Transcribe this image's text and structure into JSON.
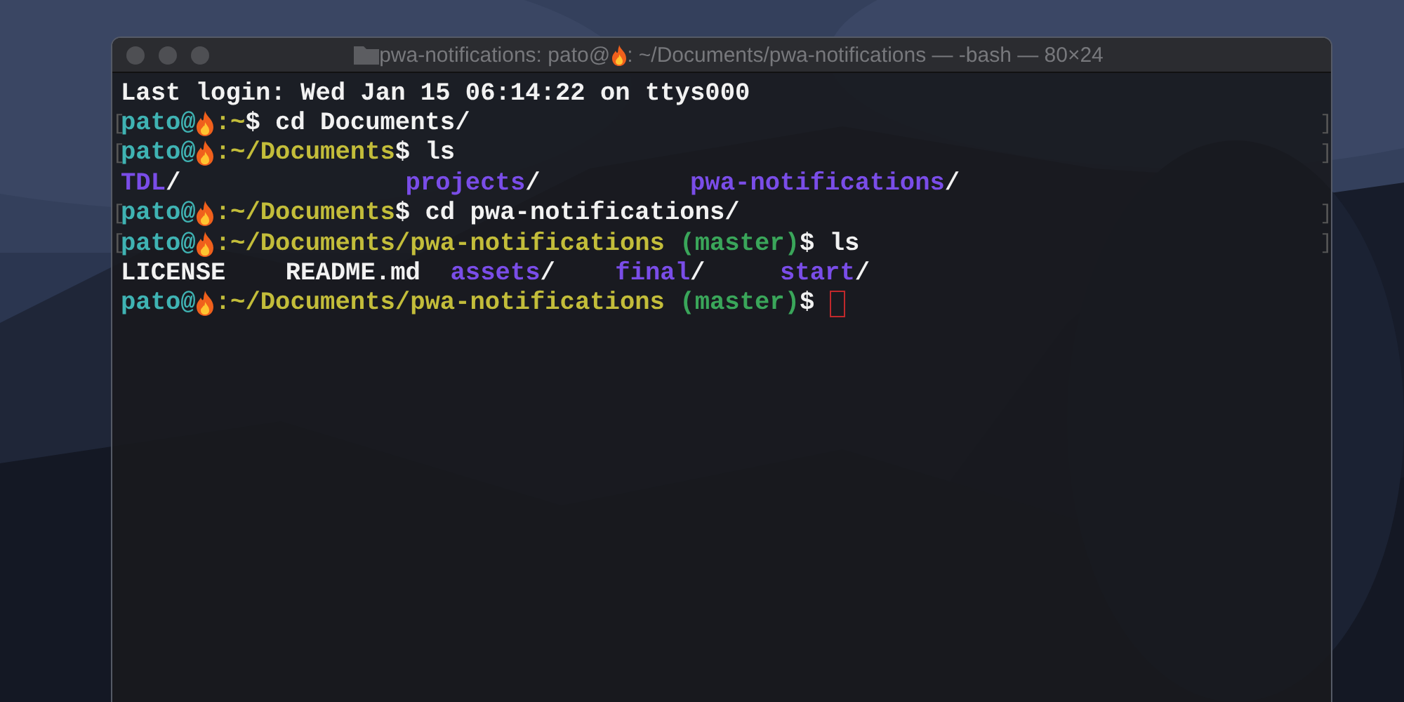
{
  "window": {
    "title_before": "pwa-notifications: pato@",
    "title_after": ": ~/Documents/pwa-notifications — -bash — 80×24"
  },
  "lines": [
    {
      "segments": [
        {
          "kind": "plain",
          "text": "Last login: Wed Jan 15 06:14:22 on ttys000"
        }
      ]
    },
    {
      "left_mark": "[",
      "right_mark": "]",
      "segments": [
        {
          "kind": "user",
          "text": "pato@"
        },
        {
          "kind": "flame"
        },
        {
          "kind": "path",
          "text": ":~"
        },
        {
          "kind": "plain",
          "text": "$ cd Documents/"
        }
      ]
    },
    {
      "left_mark": "[",
      "right_mark": "]",
      "segments": [
        {
          "kind": "user",
          "text": "pato@"
        },
        {
          "kind": "flame"
        },
        {
          "kind": "path",
          "text": ":~/Documents"
        },
        {
          "kind": "plain",
          "text": "$ ls"
        }
      ]
    },
    {
      "segments": [
        {
          "kind": "dir",
          "text": "TDL"
        },
        {
          "kind": "plain",
          "text": "/               "
        },
        {
          "kind": "dir",
          "text": "projects"
        },
        {
          "kind": "plain",
          "text": "/          "
        },
        {
          "kind": "dir",
          "text": "pwa-notifications"
        },
        {
          "kind": "plain",
          "text": "/"
        }
      ]
    },
    {
      "left_mark": "[",
      "right_mark": "]",
      "segments": [
        {
          "kind": "user",
          "text": "pato@"
        },
        {
          "kind": "flame"
        },
        {
          "kind": "path",
          "text": ":~/Documents"
        },
        {
          "kind": "plain",
          "text": "$ cd pwa-notifications/"
        }
      ]
    },
    {
      "left_mark": "[",
      "right_mark": "]",
      "segments": [
        {
          "kind": "user",
          "text": "pato@"
        },
        {
          "kind": "flame"
        },
        {
          "kind": "path",
          "text": ":~/Documents/pwa-notifications"
        },
        {
          "kind": "branch",
          "text": " (master)"
        },
        {
          "kind": "plain",
          "text": "$ ls"
        }
      ]
    },
    {
      "segments": [
        {
          "kind": "plain",
          "text": "LICENSE    README.md  "
        },
        {
          "kind": "dir",
          "text": "assets"
        },
        {
          "kind": "plain",
          "text": "/    "
        },
        {
          "kind": "dir",
          "text": "final"
        },
        {
          "kind": "plain",
          "text": "/     "
        },
        {
          "kind": "dir",
          "text": "start"
        },
        {
          "kind": "plain",
          "text": "/"
        }
      ]
    },
    {
      "segments": [
        {
          "kind": "user",
          "text": "pato@"
        },
        {
          "kind": "flame"
        },
        {
          "kind": "path",
          "text": ":~/Documents/pwa-notifications"
        },
        {
          "kind": "branch",
          "text": " (master)"
        },
        {
          "kind": "plain",
          "text": "$ "
        },
        {
          "kind": "cursor"
        }
      ]
    }
  ]
}
